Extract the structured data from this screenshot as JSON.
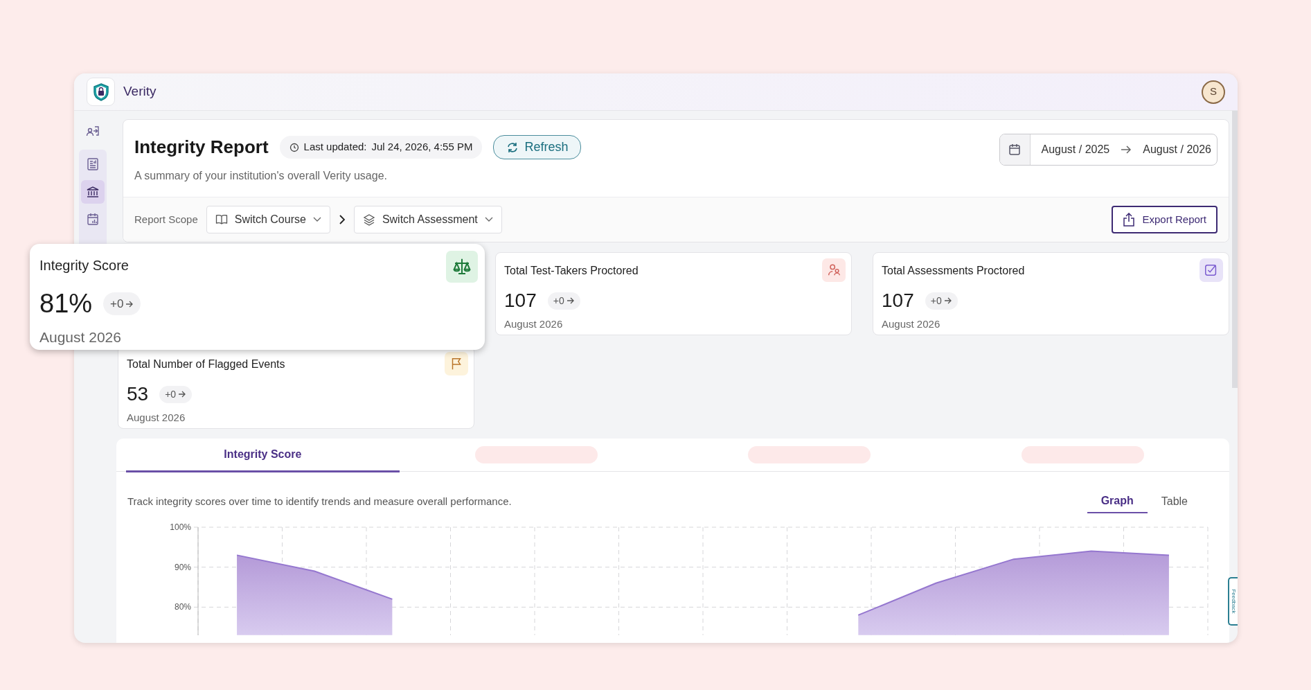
{
  "app": {
    "name": "Verity",
    "avatar": "S"
  },
  "sidebar": {
    "items": [
      {
        "kind": "sign-in",
        "selected": false
      },
      {
        "kind": "report",
        "selected": false
      },
      {
        "kind": "institution",
        "selected": true
      },
      {
        "kind": "calendar",
        "selected": false
      }
    ]
  },
  "header": {
    "title": "Integrity Report",
    "last_updated_label": "Last updated:",
    "last_updated": "Jul 24, 2026, 4:55 PM",
    "refresh": "Refresh",
    "subtitle": "A summary of your institution's overall Verity usage.",
    "date_from": "August / 2025",
    "date_to": "August / 2026"
  },
  "scope": {
    "label": "Report Scope",
    "course": "Switch Course",
    "assessment": "Switch Assessment",
    "export": "Export Report"
  },
  "stats": [
    {
      "kind": "score",
      "title": "Integrity Score",
      "value": "81%",
      "change": "+0",
      "period": "August 2026",
      "highlighted": true
    },
    {
      "kind": "people",
      "title": "Total Test-Takers Proctored",
      "value": "107",
      "change": "+0",
      "period": "August 2026",
      "highlighted": false
    },
    {
      "kind": "check",
      "title": "Total Assessments Proctored",
      "value": "107",
      "change": "+0",
      "period": "August 2026",
      "highlighted": false
    },
    {
      "kind": "flag",
      "title": "Total Number of Flagged Events",
      "value": "53",
      "change": "+0",
      "period": "August 2026",
      "highlighted": false
    }
  ],
  "tabs": [
    {
      "label": "Integrity Score",
      "selected": true
    },
    {
      "selected": false
    },
    {
      "selected": false
    },
    {
      "selected": false
    }
  ],
  "panel": {
    "description": "Track integrity scores over time to identify trends and measure overall performance.",
    "views": [
      {
        "label": "Graph",
        "selected": true
      },
      {
        "label": "Table",
        "selected": false
      }
    ],
    "chart_data": {
      "type": "area",
      "grid": true,
      "categories": [
        null,
        null,
        null,
        null,
        null,
        null,
        null,
        null,
        null,
        null,
        null,
        null,
        null
      ],
      "ylim": [
        73,
        100
      ],
      "yticks": [
        {
          "value": 80,
          "label": "80%"
        },
        {
          "value": 90,
          "label": "90%"
        },
        {
          "value": 100,
          "label": "100%"
        }
      ],
      "series": [
        {
          "color": "#9577cf",
          "values": [
            93,
            89,
            82,
            null,
            null,
            null,
            null,
            null,
            78,
            86,
            92,
            94,
            93
          ]
        }
      ]
    }
  },
  "feedback": "Feedback"
}
